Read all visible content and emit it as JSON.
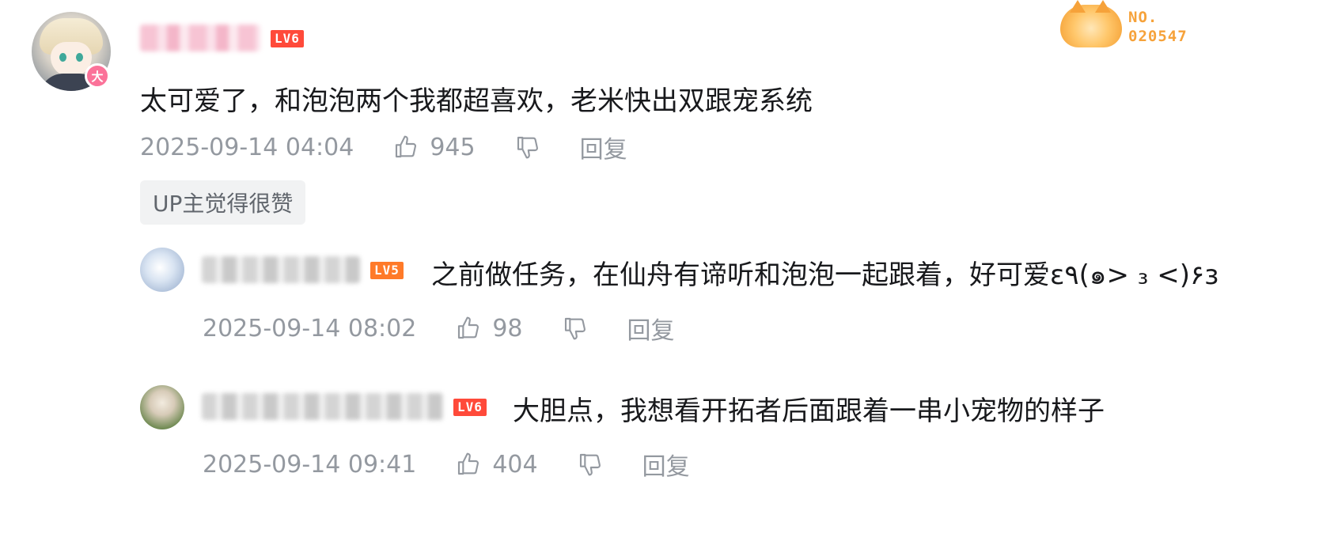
{
  "comment": {
    "avatar_badge": "大",
    "level": "LV6",
    "text": "太可爱了，和泡泡两个我都超喜欢，老米快出双跟宠系统",
    "time": "2025-09-14 04:04",
    "likes": "945",
    "reply_label": "回复",
    "up_tag": "UP主觉得很赞"
  },
  "fan_badge": {
    "line1": "NO.",
    "line2": "020547"
  },
  "replies": [
    {
      "level": "LV5",
      "text": "之前做任务，在仙舟有谛听和泡泡一起跟着，好可爱ε٩(๑> ₃ <)۶з",
      "time": "2025-09-14 08:02",
      "likes": "98",
      "reply_label": "回复"
    },
    {
      "level": "LV6",
      "text": "大胆点，我想看开拓者后面跟着一串小宠物的样子",
      "time": "2025-09-14 09:41",
      "likes": "404",
      "reply_label": "回复"
    }
  ],
  "icons": {
    "like": "thumb-up-icon",
    "dislike": "thumb-down-icon"
  },
  "colors": {
    "lv6": "#ff4a3a",
    "lv5": "#ff7a29",
    "meta_gray": "#9499a0",
    "badge_pink": "#fb7299",
    "fan_orange": "#f6a23a"
  }
}
